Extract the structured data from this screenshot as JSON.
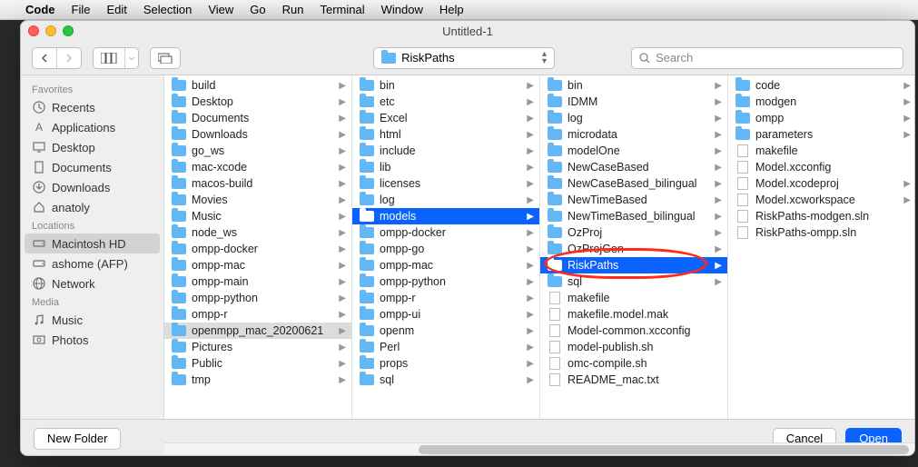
{
  "menubar": {
    "app": "Code",
    "items": [
      "File",
      "Edit",
      "Selection",
      "View",
      "Go",
      "Run",
      "Terminal",
      "Window",
      "Help"
    ]
  },
  "window": {
    "title": "Untitled-1"
  },
  "toolbar": {
    "path_label": "RiskPaths",
    "search_placeholder": "Search"
  },
  "sidebar": {
    "sections": [
      {
        "label": "Favorites",
        "items": [
          {
            "icon": "recents",
            "label": "Recents"
          },
          {
            "icon": "applications",
            "label": "Applications"
          },
          {
            "icon": "desktop",
            "label": "Desktop"
          },
          {
            "icon": "documents",
            "label": "Documents"
          },
          {
            "icon": "downloads",
            "label": "Downloads"
          },
          {
            "icon": "home",
            "label": "anatoly"
          }
        ]
      },
      {
        "label": "Locations",
        "items": [
          {
            "icon": "disk",
            "label": "Macintosh HD",
            "selected": true
          },
          {
            "icon": "disk",
            "label": "ashome (AFP)"
          },
          {
            "icon": "network",
            "label": "Network"
          }
        ]
      },
      {
        "label": "Media",
        "items": [
          {
            "icon": "music",
            "label": "Music"
          },
          {
            "icon": "photos",
            "label": "Photos"
          }
        ]
      }
    ]
  },
  "columns": [
    {
      "entries": [
        {
          "t": "folder",
          "n": "build"
        },
        {
          "t": "folder",
          "n": "Desktop"
        },
        {
          "t": "folder",
          "n": "Documents"
        },
        {
          "t": "folder",
          "n": "Downloads"
        },
        {
          "t": "folder",
          "n": "go_ws"
        },
        {
          "t": "folder",
          "n": "mac-xcode"
        },
        {
          "t": "folder",
          "n": "macos-build"
        },
        {
          "t": "folder",
          "n": "Movies"
        },
        {
          "t": "folder",
          "n": "Music"
        },
        {
          "t": "folder",
          "n": "node_ws"
        },
        {
          "t": "folder",
          "n": "ompp-docker"
        },
        {
          "t": "folder",
          "n": "ompp-mac"
        },
        {
          "t": "folder",
          "n": "ompp-main"
        },
        {
          "t": "folder",
          "n": "ompp-python"
        },
        {
          "t": "folder",
          "n": "ompp-r"
        },
        {
          "t": "folder",
          "n": "openmpp_mac_20200621",
          "sel": "gray"
        },
        {
          "t": "folder",
          "n": "Pictures"
        },
        {
          "t": "folder",
          "n": "Public"
        },
        {
          "t": "folder",
          "n": "tmp"
        }
      ]
    },
    {
      "entries": [
        {
          "t": "folder",
          "n": "bin"
        },
        {
          "t": "folder",
          "n": "etc"
        },
        {
          "t": "folder",
          "n": "Excel"
        },
        {
          "t": "folder",
          "n": "html"
        },
        {
          "t": "folder",
          "n": "include"
        },
        {
          "t": "folder",
          "n": "lib"
        },
        {
          "t": "folder",
          "n": "licenses"
        },
        {
          "t": "folder",
          "n": "log"
        },
        {
          "t": "folder",
          "n": "models",
          "sel": "blue"
        },
        {
          "t": "folder",
          "n": "ompp-docker"
        },
        {
          "t": "folder",
          "n": "ompp-go"
        },
        {
          "t": "folder",
          "n": "ompp-mac"
        },
        {
          "t": "folder",
          "n": "ompp-python"
        },
        {
          "t": "folder",
          "n": "ompp-r"
        },
        {
          "t": "folder",
          "n": "ompp-ui"
        },
        {
          "t": "folder",
          "n": "openm"
        },
        {
          "t": "folder",
          "n": "Perl"
        },
        {
          "t": "folder",
          "n": "props"
        },
        {
          "t": "folder",
          "n": "sql"
        }
      ]
    },
    {
      "entries": [
        {
          "t": "folder",
          "n": "bin"
        },
        {
          "t": "folder",
          "n": "IDMM"
        },
        {
          "t": "folder",
          "n": "log"
        },
        {
          "t": "folder",
          "n": "microdata"
        },
        {
          "t": "folder",
          "n": "modelOne"
        },
        {
          "t": "folder",
          "n": "NewCaseBased"
        },
        {
          "t": "folder",
          "n": "NewCaseBased_bilingual"
        },
        {
          "t": "folder",
          "n": "NewTimeBased"
        },
        {
          "t": "folder",
          "n": "NewTimeBased_bilingual"
        },
        {
          "t": "folder",
          "n": "OzProj"
        },
        {
          "t": "folder",
          "n": "OzProjGen"
        },
        {
          "t": "folder",
          "n": "RiskPaths",
          "sel": "blue",
          "annot": true
        },
        {
          "t": "folder",
          "n": "sql"
        },
        {
          "t": "file",
          "n": "makefile",
          "noChev": true
        },
        {
          "t": "file",
          "n": "makefile.model.mak",
          "noChev": true
        },
        {
          "t": "file",
          "n": "Model-common.xcconfig",
          "noChev": true
        },
        {
          "t": "file",
          "n": "model-publish.sh",
          "noChev": true
        },
        {
          "t": "file",
          "n": "omc-compile.sh",
          "noChev": true
        },
        {
          "t": "file",
          "n": "README_mac.txt",
          "noChev": true
        }
      ]
    },
    {
      "entries": [
        {
          "t": "folder",
          "n": "code"
        },
        {
          "t": "folder",
          "n": "modgen"
        },
        {
          "t": "folder",
          "n": "ompp"
        },
        {
          "t": "folder",
          "n": "parameters"
        },
        {
          "t": "file",
          "n": "makefile",
          "noChev": true
        },
        {
          "t": "file",
          "n": "Model.xcconfig",
          "noChev": true
        },
        {
          "t": "file",
          "n": "Model.xcodeproj"
        },
        {
          "t": "file",
          "n": "Model.xcworkspace"
        },
        {
          "t": "file",
          "n": "RiskPaths-modgen.sln",
          "noChev": true
        },
        {
          "t": "file",
          "n": "RiskPaths-ompp.sln",
          "noChev": true
        }
      ]
    }
  ],
  "bottombar": {
    "new_folder": "New Folder",
    "cancel": "Cancel",
    "open": "Open"
  }
}
